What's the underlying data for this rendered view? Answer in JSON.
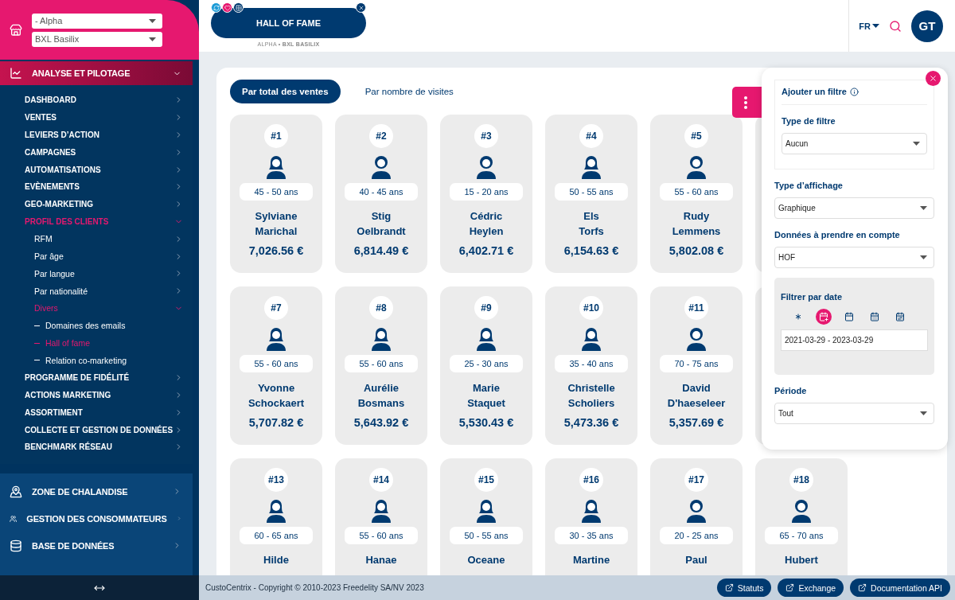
{
  "store_selects": [
    {
      "value": "- Alpha"
    },
    {
      "value": "BXL Basilix"
    }
  ],
  "menu": [
    {
      "kind": "chart",
      "label": "ANALYSE ET PILOTAGE",
      "expanded": true,
      "selected": true,
      "children": [
        {
          "label": "DASHBOARD",
          "expanded": false,
          "selected": false
        },
        {
          "label": "VENTES",
          "expanded": false,
          "selected": false
        },
        {
          "label": "LEVIERS D’ACTION",
          "expanded": false,
          "selected": false
        },
        {
          "label": "CAMPAGNES",
          "expanded": false,
          "selected": false
        },
        {
          "label": "AUTOMATISATIONS",
          "expanded": false,
          "selected": false
        },
        {
          "label": "EVÈNEMENTS",
          "expanded": false,
          "selected": false
        },
        {
          "label": "GEO-MARKETING",
          "expanded": false,
          "selected": false
        },
        {
          "label": "PROFIL DES CLIENTS",
          "expanded": true,
          "selected": true,
          "children": [
            {
              "label": "RFM",
              "expanded": false,
              "selected": false
            },
            {
              "label": "Par âge",
              "expanded": false,
              "selected": false
            },
            {
              "label": "Par langue",
              "expanded": false,
              "selected": false
            },
            {
              "label": "Par nationalité",
              "expanded": false,
              "selected": false
            },
            {
              "label": "Divers",
              "expanded": true,
              "selected": true,
              "children": [
                {
                  "label": "Domaines des emails",
                  "selected": false
                },
                {
                  "label": "Hall of fame",
                  "selected": true
                },
                {
                  "label": "Relation co-marketing",
                  "selected": false
                }
              ]
            }
          ]
        },
        {
          "label": "PROGRAMME DE FIDÉLITÉ",
          "expanded": false,
          "selected": false
        },
        {
          "label": "ACTIONS MARKETING",
          "expanded": false,
          "selected": false
        },
        {
          "label": "ASSORTIMENT",
          "expanded": false,
          "selected": false
        },
        {
          "label": "COLLECTE ET GESTION DE DONNÉES",
          "expanded": false,
          "selected": false
        },
        {
          "label": "BENCHMARK RÉSEAU",
          "expanded": false,
          "selected": false
        }
      ]
    },
    {
      "kind": "map",
      "label": "ZONE DE CHALANDISE",
      "expanded": false,
      "selected": false
    },
    {
      "kind": "people",
      "label": "GESTION DES CONSOMMATEURS",
      "expanded": false,
      "selected": false
    },
    {
      "kind": "database",
      "label": "BASE DE DONNÉES",
      "expanded": false,
      "selected": false
    }
  ],
  "page_tab": {
    "title": "HALL OF FAME",
    "subtitle": "ALPHA • **BXL BASILIX**"
  },
  "language": "FR",
  "avatar": "GT",
  "view_tabs": [
    {
      "label": "Par total des ventes",
      "selected": true
    },
    {
      "label": "Par nombre de visites",
      "selected": false
    }
  ],
  "cards": [
    {
      "kind": "female",
      "rank": "#1",
      "age": "45 - 50 ans",
      "name": "Sylviane Marichal",
      "amount": "7,026.56 €"
    },
    {
      "kind": "male",
      "rank": "#2",
      "age": "40 - 45 ans",
      "name": "Stig Oelbrandt",
      "amount": "6,814.49 €"
    },
    {
      "kind": "male",
      "rank": "#3",
      "age": "15 - 20 ans",
      "name": "Cédric Heylen",
      "amount": "6,402.71 €"
    },
    {
      "kind": "female",
      "rank": "#4",
      "age": "50 - 55 ans",
      "name": "Els Torfs",
      "amount": "6,154.63 €"
    },
    {
      "kind": "male",
      "rank": "#5",
      "age": "55 - 60 ans",
      "name": "Rudy Lemmens",
      "amount": "5,802.08 €"
    },
    {
      "kind": "covered"
    },
    {
      "kind": "female",
      "rank": "#7",
      "age": "55 - 60 ans",
      "name": "Yvonne Schockaert",
      "amount": "5,707.82 €"
    },
    {
      "kind": "female",
      "rank": "#8",
      "age": "55 - 60 ans",
      "name": "Aurélie Bosmans",
      "amount": "5,643.92 €"
    },
    {
      "kind": "female",
      "rank": "#9",
      "age": "25 - 30 ans",
      "name": "Marie Staquet",
      "amount": "5,530.43 €"
    },
    {
      "kind": "female",
      "rank": "#10",
      "age": "35 - 40 ans",
      "name": "Christelle Scholiers",
      "amount": "5,473.36 €"
    },
    {
      "kind": "male",
      "rank": "#11",
      "age": "70 - 75 ans",
      "name": "David D'haeseleer",
      "amount": "5,357.69 €"
    },
    {
      "kind": "covered"
    },
    {
      "kind": "female",
      "rank": "#13",
      "age": "60 - 65 ans",
      "name": "Hilde"
    },
    {
      "kind": "female",
      "rank": "#14",
      "age": "55 - 60 ans",
      "name": "Hanae"
    },
    {
      "kind": "female",
      "rank": "#15",
      "age": "50 - 55 ans",
      "name": "Oceane"
    },
    {
      "kind": "female",
      "rank": "#16",
      "age": "30 - 35 ans",
      "name": "Martine"
    },
    {
      "kind": "male",
      "rank": "#17",
      "age": "20 - 25 ans",
      "name": "Paul"
    },
    {
      "kind": "male",
      "rank": "#18",
      "age": "65 - 70 ans",
      "name": "Hubert"
    }
  ],
  "filter_panel": {
    "title": "Ajouter un filtre",
    "filter_type": {
      "label": "Type de filtre",
      "value": "Aucun"
    },
    "display_type": {
      "label": "Type d’affichage",
      "value": "Graphique"
    },
    "data_scope": {
      "label": "Données à prendre en compte",
      "value": "HOF"
    },
    "date_filter": {
      "label": "Filtrer par date",
      "modes": [
        {
          "kind": "all",
          "selected": false
        },
        {
          "kind": "custom",
          "selected": true
        },
        {
          "kind": "day",
          "selected": false
        },
        {
          "kind": "month",
          "selected": false
        },
        {
          "kind": "week",
          "selected": false
        }
      ],
      "value": "2021-03-29 - 2023-03-29"
    },
    "period": {
      "label": "Période",
      "value": "Tout"
    }
  },
  "footer": {
    "copyright": "CustoCentrix - Copyright © 2010-2023 Freedelity SA/NV 2023",
    "links": [
      "Statuts",
      "Exchange",
      "Documentation API"
    ]
  }
}
